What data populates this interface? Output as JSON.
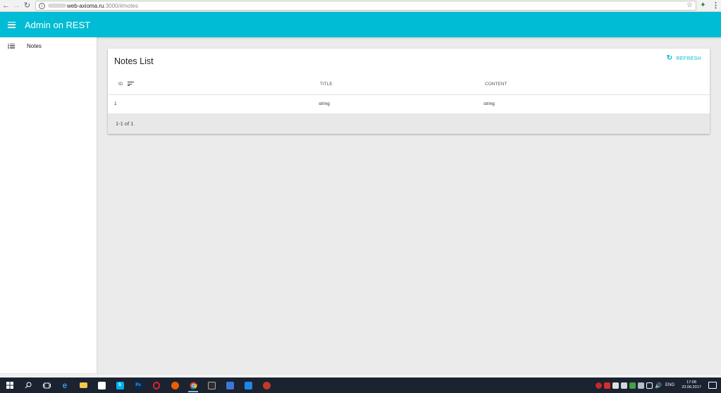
{
  "browser": {
    "url_host": "web-axioma.ru",
    "url_port_path": ":3000/#/notes"
  },
  "appbar": {
    "title": "Admin on REST",
    "color": "#00bcd4"
  },
  "sidebar": {
    "items": [
      {
        "label": "Notes",
        "icon": "list-icon"
      }
    ]
  },
  "card": {
    "title": "Notes List",
    "refresh_label": "REFRESH",
    "columns": [
      "ID",
      "TITLE",
      "CONTENT"
    ],
    "rows": [
      {
        "id": "1",
        "title": "string",
        "content": "string"
      }
    ],
    "pagination": "1-1 of 1"
  },
  "taskbar": {
    "lang": "ENG",
    "time": "17:08",
    "date": "23.06.2017"
  }
}
